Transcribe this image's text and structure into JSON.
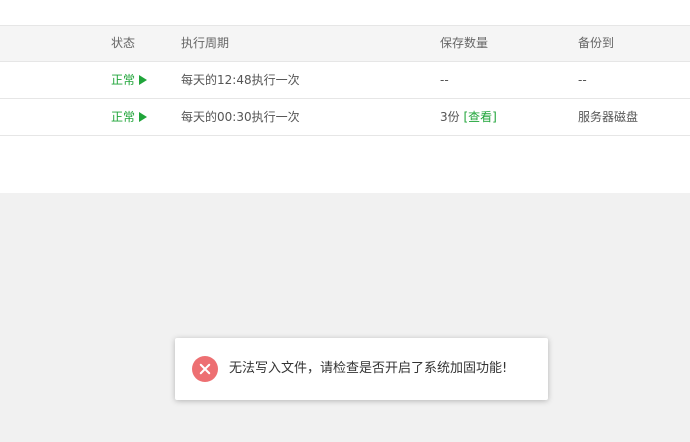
{
  "table": {
    "headers": {
      "status": "状态",
      "cycle": "执行周期",
      "keep": "保存数量",
      "target": "备份到"
    },
    "rows": [
      {
        "status": "正常",
        "cycle": "每天的12:48执行一次",
        "keep": "--",
        "keep_link": "",
        "target": "--"
      },
      {
        "status": "正常",
        "cycle": "每天的00:30执行一次",
        "keep": "3份",
        "keep_link": "[查看]",
        "target": "服务器磁盘"
      }
    ]
  },
  "toast": {
    "icon": "error-icon",
    "message": "无法写入文件，请检查是否开启了系统加固功能!",
    "color": "#ed6f72"
  },
  "colors": {
    "accent": "#20a53a",
    "error": "#ed6f72"
  }
}
